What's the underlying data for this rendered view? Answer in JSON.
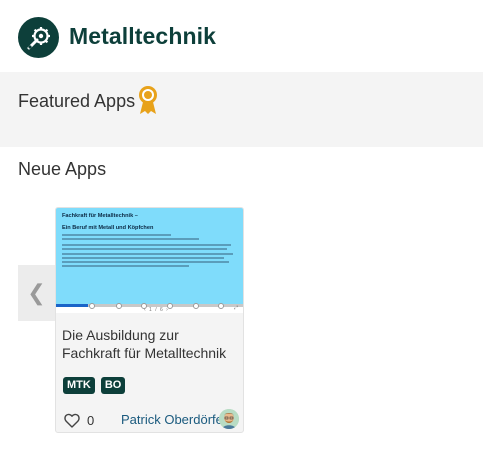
{
  "header": {
    "title": "Metalltechnik",
    "logo_icon": "gear-wrench-icon"
  },
  "featured": {
    "title": "Featured Apps",
    "icon": "award-icon",
    "icon_color": "#e8a21a"
  },
  "new_apps": {
    "title": "Neue Apps",
    "prev_label": "❮"
  },
  "card": {
    "preview": {
      "heading": "Fachkraft für Metalltechnik –",
      "subheading": "Ein Beruf mit Metall und Köpfchen",
      "progress": 0.17,
      "nav": "‹ 1 / 6 ›",
      "fullscreen": "⤢"
    },
    "title": "Die Ausbildung zur Fachkraft für Metalltechnik",
    "tags": [
      "MTK",
      "BO"
    ],
    "likes": "0",
    "author": "Patrick Oberdörfer"
  },
  "colors": {
    "brand": "#0d3f3a",
    "preview_bg": "#7fdcfb",
    "author_link": "#1a5a7e"
  }
}
